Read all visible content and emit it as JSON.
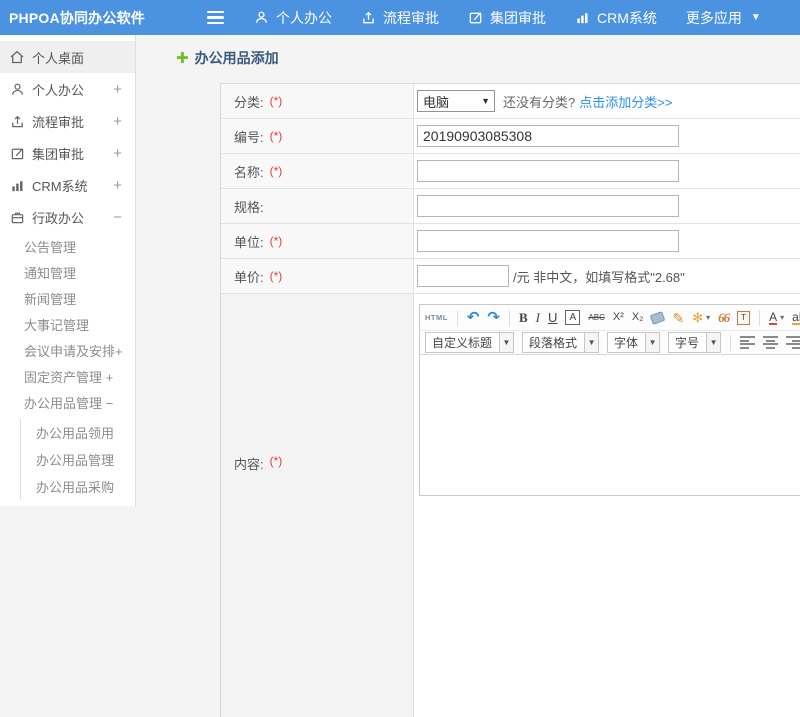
{
  "colors": {
    "topbar": "#4b93e1",
    "link": "#2d8ff0",
    "required": "#e2413e",
    "title": "#3c5a7e",
    "plus_green": "#72bf2e"
  },
  "topbar": {
    "logo": "PHPOA协同办公软件",
    "nav": [
      {
        "label": "个人办公"
      },
      {
        "label": "流程审批"
      },
      {
        "label": "集团审批"
      },
      {
        "label": "CRM系统"
      },
      {
        "label": "更多应用"
      }
    ]
  },
  "sidebar": {
    "items": [
      {
        "label": "个人桌面",
        "expand": ""
      },
      {
        "label": "个人办公",
        "expand": "+"
      },
      {
        "label": "流程审批",
        "expand": "+"
      },
      {
        "label": "集团审批",
        "expand": "+"
      },
      {
        "label": "CRM系统",
        "expand": "+"
      },
      {
        "label": "行政办公",
        "expand": "−"
      }
    ],
    "submenu": [
      {
        "label": "公告管理"
      },
      {
        "label": "通知管理"
      },
      {
        "label": "新闻管理"
      },
      {
        "label": "大事记管理"
      },
      {
        "label": "会议申请及安排+"
      },
      {
        "label": "固定资产管理 +"
      },
      {
        "label": "办公用品管理 −"
      }
    ],
    "subsubmenu": [
      {
        "label": "办公用品领用"
      },
      {
        "label": "办公用品管理"
      },
      {
        "label": "办公用品采购"
      }
    ]
  },
  "main": {
    "title": "办公用品添加",
    "form": {
      "category": {
        "label": "分类:",
        "required": "(*)",
        "selected": "电脑",
        "caret": "▼",
        "hint": "还没有分类?",
        "link": "点击添加分类>>"
      },
      "code": {
        "label": "编号:",
        "required": "(*)",
        "value": "20190903085308"
      },
      "name": {
        "label": "名称:",
        "required": "(*)",
        "value": ""
      },
      "spec": {
        "label": "规格:",
        "required": "",
        "value": ""
      },
      "unit": {
        "label": "单位:",
        "required": "(*)",
        "value": ""
      },
      "price": {
        "label": "单价:",
        "required": "(*)",
        "value": "",
        "suffix": "/元 非中文，如填写格式\"2.68\""
      },
      "content": {
        "label": "内容:",
        "required": "(*)"
      }
    }
  },
  "editor": {
    "row1": {
      "source": "HTML",
      "undo": "↶",
      "redo": "↷",
      "bold": "B",
      "italic": "I",
      "underline": "U",
      "fontbox": "A",
      "strike": "ABC",
      "sup": "X²",
      "sub": "X₂",
      "brush": "✎",
      "wand": "✻",
      "quote": "66",
      "paste": "T",
      "fontcolor": "A",
      "highlight": "ab",
      "caret": "▾"
    },
    "row2": {
      "heading": "自定义标题",
      "paragraph": "段落格式",
      "font": "字体",
      "size": "字号",
      "caret": "▼",
      "link": "∞"
    }
  }
}
